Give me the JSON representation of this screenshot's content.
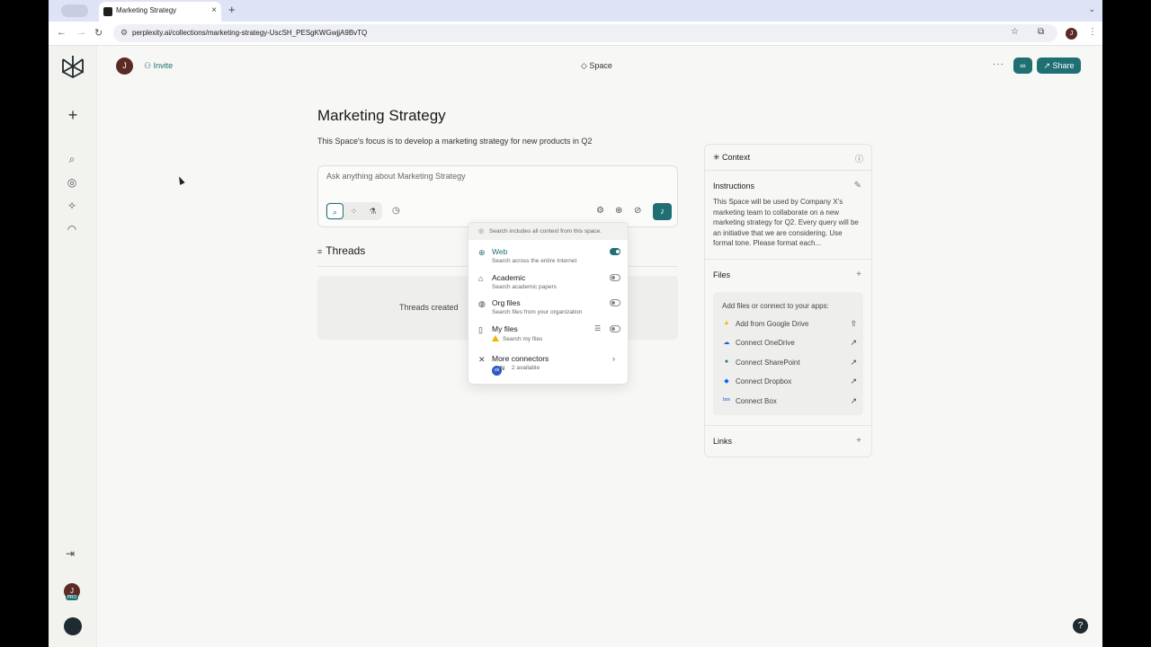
{
  "browser": {
    "tab_title": "Marketing Strategy",
    "url": "perplexity.ai/collections/marketing-strategy-UscSH_PESgKWGwjjA9BvTQ",
    "profile_initial": "J"
  },
  "sidebar": {
    "icons": [
      "logo-icon",
      "plus-icon",
      "discover-search-icon",
      "globe-icon",
      "spaces-icon",
      "signal-icon"
    ],
    "user_initial": "J",
    "pro_badge": "PRO"
  },
  "topbar": {
    "avatar_initial": "J",
    "invite_label": "Invite",
    "space_label": "Space",
    "share_label": "Share"
  },
  "main": {
    "title": "Marketing Strategy",
    "description": "This Space's focus is to develop a marketing strategy for new products in Q2",
    "ask_placeholder": "Ask anything about Marketing Strategy",
    "threads_label": "Threads",
    "threads_empty": "Threads created"
  },
  "sources_dropdown": {
    "header": "Search includes all context from this space.",
    "items": [
      {
        "label": "Web",
        "sub": "Search across the entire Internet",
        "on": true
      },
      {
        "label": "Academic",
        "sub": "Search academic papers",
        "on": false
      },
      {
        "label": "Org files",
        "sub": "Search files from your organization",
        "on": false
      },
      {
        "label": "My files",
        "sub": "Search my files",
        "on": false
      }
    ],
    "more": {
      "label": "More connectors",
      "sub": "2 available"
    }
  },
  "context": {
    "title": "Context",
    "instructions_title": "Instructions",
    "instructions_text": "This Space will be used by Company X's marketing team to collaborate on a new marketing strategy for Q2. Every query will be an initiative that we are considering. Use formal tone. Please format each...",
    "files_title": "Files",
    "files_hint": "Add files or connect to your apps:",
    "file_sources": [
      {
        "label": "Add from Google Drive",
        "color": "#f4b400"
      },
      {
        "label": "Connect OneDrive",
        "color": "#0a64d8"
      },
      {
        "label": "Connect SharePoint",
        "color": "#038387"
      },
      {
        "label": "Connect Dropbox",
        "color": "#0061ff"
      },
      {
        "label": "Connect Box",
        "color": "#0b5cd5"
      }
    ],
    "links_title": "Links"
  },
  "colors": {
    "accent": "#1f6f73",
    "background": "#f7f7f5"
  }
}
